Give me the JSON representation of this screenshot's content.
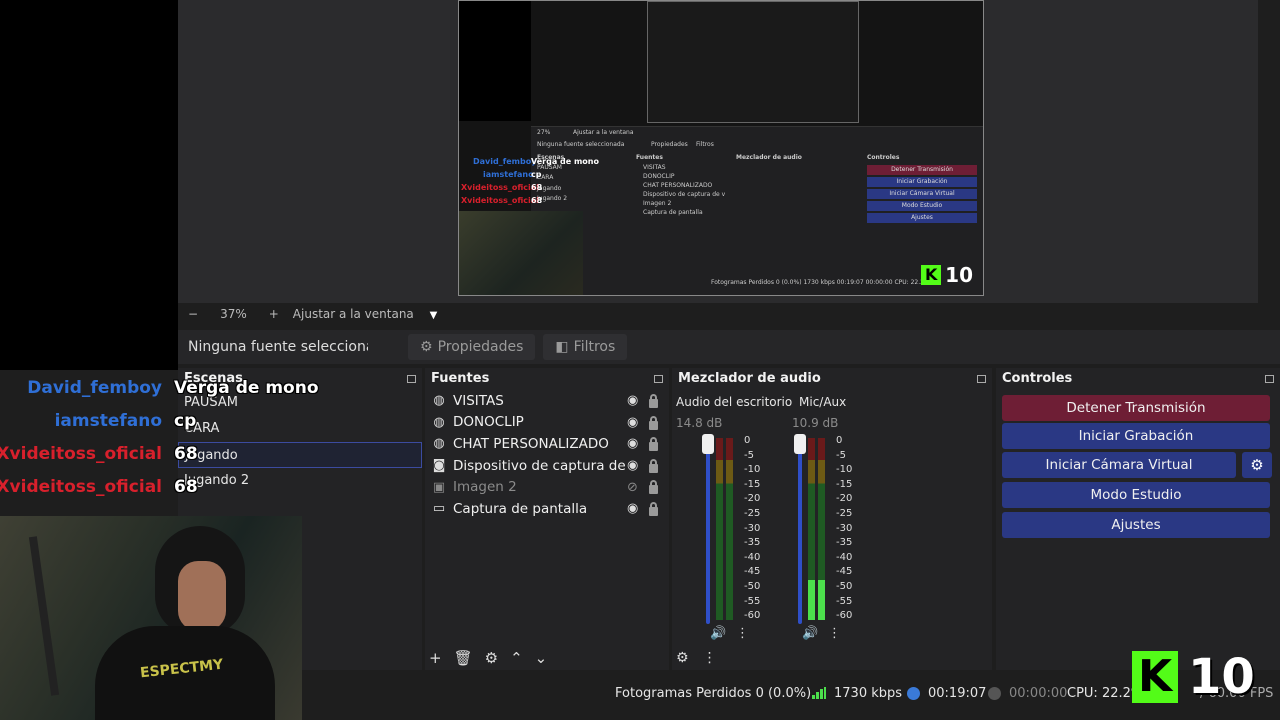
{
  "preview": {
    "mini": {
      "zoom_text": "27%",
      "fit_text": "Ajustar a la ventana",
      "no_source": "Ninguna fuente seleccionada",
      "properties": "Propiedades",
      "filters": "Filtros",
      "scenes_title": "Escenas",
      "sources_title": "Fuentes",
      "mixer_title": "Mezclador de audio",
      "controls_title": "Controles",
      "scenes": [
        "PAUSAM",
        "CARA",
        "Jugando",
        "Jugando 2"
      ],
      "sources": [
        "VISITAS",
        "DONOCLIP",
        "CHAT PERSONALIZADO",
        "Dispositivo de captura de v",
        "Imagen 2",
        "Captura de pantalla"
      ],
      "controls": [
        "Detener Transmisión",
        "Iniciar Grabación",
        "Iniciar Cámara Virtual",
        "Modo Estudio",
        "Ajustes"
      ],
      "status": "Fotogramas Perdidos 0 (0.0%)   1730 kbps   00:19:07   00:00:00   CPU: 22.2",
      "chat": [
        {
          "user": "David_femboy",
          "msg": "Verga de mono"
        },
        {
          "user": "iamstefano",
          "msg": "cp"
        },
        {
          "user": "Xvideitoss_oficial",
          "msg": "68"
        },
        {
          "user": "Xvideitoss_oficial",
          "msg": "68"
        }
      ],
      "kick_count": "10"
    }
  },
  "zoom": {
    "minus": "−",
    "percent": "37%",
    "plus": "+",
    "fit": "Ajustar a la ventana",
    "caret": "▼"
  },
  "toolbar": {
    "no_source": "Ninguna fuente seleccionad",
    "properties": "Propiedades",
    "filters": "Filtros"
  },
  "scenes": {
    "title": "Escenas",
    "items": [
      "PAUSAM",
      "CARA",
      "Jugando",
      "Jugando 2"
    ],
    "selected": "Jugando"
  },
  "sources": {
    "title": "Fuentes",
    "items": [
      {
        "name": "VISITAS",
        "icon": "globe-icon",
        "visible": true
      },
      {
        "name": "DONOCLIP",
        "icon": "globe-icon",
        "visible": true
      },
      {
        "name": "CHAT PERSONALIZADO",
        "icon": "globe-icon",
        "visible": true
      },
      {
        "name": "Dispositivo de captura de v",
        "icon": "camera-icon",
        "visible": true
      },
      {
        "name": "Imagen 2",
        "icon": "image-icon",
        "visible": false
      },
      {
        "name": "Captura de pantalla",
        "icon": "monitor-icon",
        "visible": true
      }
    ]
  },
  "mixer": {
    "title": "Mezclador de audio",
    "channels": [
      {
        "name": "Audio del escritorio",
        "db": "14.8 dB",
        "level": 0.0
      },
      {
        "name": "Mic/Aux",
        "db": "10.9 dB",
        "level": 0.22
      }
    ],
    "scale": [
      "0",
      "-5",
      "-10",
      "-15",
      "-20",
      "-25",
      "-30",
      "-35",
      "-40",
      "-45",
      "-50",
      "-55",
      "-60"
    ]
  },
  "controls": {
    "title": "Controles",
    "stop_stream": "Detener Transmisión",
    "start_recording": "Iniciar Grabación",
    "start_virtual_cam": "Iniciar Cámara Virtual",
    "studio_mode": "Modo Estudio",
    "settings": "Ajustes"
  },
  "status": {
    "dropped_frames": "Fotogramas Perdidos 0 (0.0%)",
    "bitrate": "1730 kbps",
    "stream_time": "00:19:07",
    "record_time": "00:00:00",
    "cpu": "CPU: 22.2%",
    "fps": "/ 60.00 FPS"
  },
  "chat": [
    {
      "user": "David_femboy",
      "msg": "Verga de mono",
      "color": "#2f6fd6"
    },
    {
      "user": "iamstefano",
      "msg": "cp",
      "color": "#2f6fd6"
    },
    {
      "user": "Xvideitoss_oficial",
      "msg": "68",
      "color": "#d8202c"
    },
    {
      "user": "Xvideitoss_oficial",
      "msg": "68",
      "color": "#d8202c"
    }
  ],
  "webcam": {
    "shirt_text": "ESPECTMY"
  },
  "kick": {
    "logo": "K",
    "count": "10",
    "color": "#53fc18"
  }
}
